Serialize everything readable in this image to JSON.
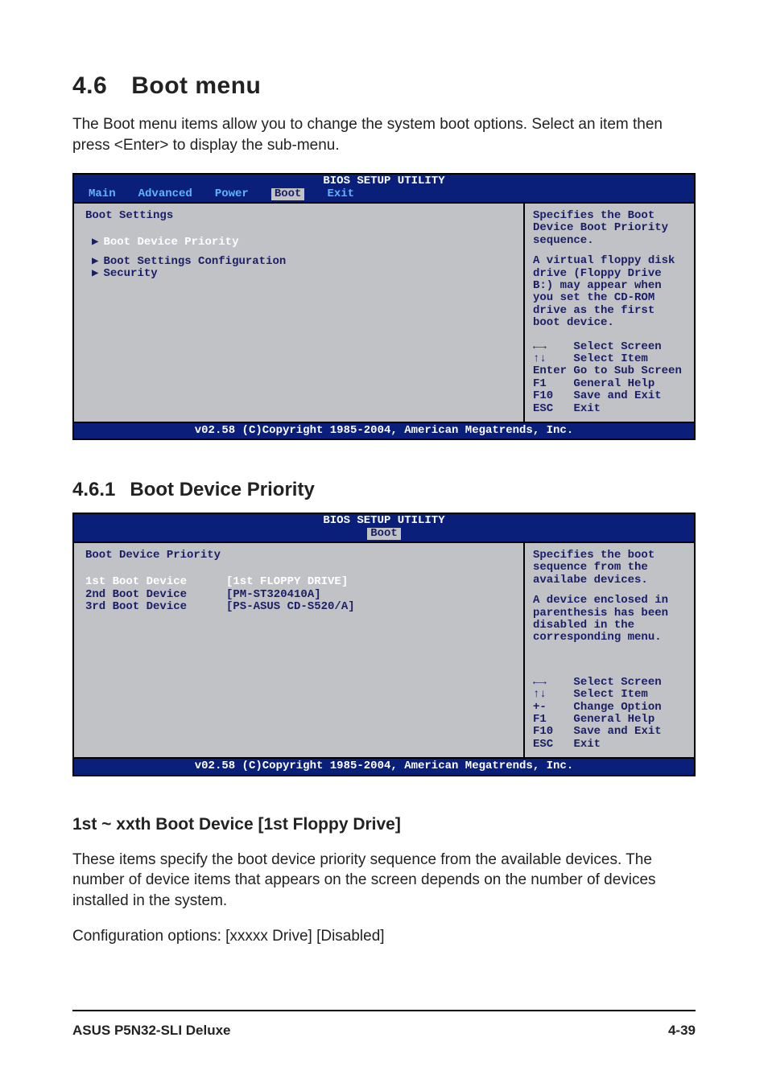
{
  "section": {
    "number": "4.6",
    "title": "Boot menu"
  },
  "intro": "The Boot menu items allow you to change the system boot options. Select an item then press <Enter> to display the sub-menu.",
  "bios1": {
    "title": "BIOS SETUP UTILITY",
    "tabs": {
      "main": "Main",
      "advanced": "Advanced",
      "power": "Power",
      "boot": "Boot",
      "exit": "Exit"
    },
    "heading": "Boot Settings",
    "items": {
      "a": "Boot Device Priority",
      "b": "Boot Settings Configuration",
      "c": "Security"
    },
    "help1": "Specifies the Boot Device Boot Priority sequence.",
    "help2": "A virtual floppy disk drive (Floppy Drive B:) may appear when you set the CD-ROM drive as the first boot device.",
    "keys": {
      "k1": {
        "sym": "←→",
        "txt": "Select Screen"
      },
      "k2": {
        "sym": "↑↓",
        "txt": "Select Item"
      },
      "k3": {
        "sym": "Enter",
        "txt": "Go to Sub Screen"
      },
      "k4": {
        "sym": "F1",
        "txt": "General Help"
      },
      "k5": {
        "sym": "F10",
        "txt": "Save and Exit"
      },
      "k6": {
        "sym": "ESC",
        "txt": "Exit"
      }
    },
    "footer": "v02.58 (C)Copyright 1985-2004, American Megatrends, Inc."
  },
  "subsection": {
    "number": "4.6.1",
    "title": "Boot Device Priority"
  },
  "bios2": {
    "title": "BIOS SETUP UTILITY",
    "tab": "Boot",
    "heading": "Boot Device Priority",
    "rows": {
      "r1": {
        "k": "1st Boot Device",
        "v": "[1st FLOPPY DRIVE]"
      },
      "r2": {
        "k": "2nd Boot Device",
        "v": "[PM-ST320410A]"
      },
      "r3": {
        "k": "3rd Boot Device",
        "v": "[PS-ASUS CD-S520/A]"
      }
    },
    "help1": "Specifies the boot sequence from the availabe devices.",
    "help2": "A device enclosed in parenthesis has been disabled in the corresponding menu.",
    "keys": {
      "k1": {
        "sym": "←→",
        "txt": "Select Screen"
      },
      "k2": {
        "sym": "↑↓",
        "txt": "Select Item"
      },
      "k3": {
        "sym": "+-",
        "txt": "Change Option"
      },
      "k4": {
        "sym": "F1",
        "txt": "General Help"
      },
      "k5": {
        "sym": "F10",
        "txt": "Save and Exit"
      },
      "k6": {
        "sym": "ESC",
        "txt": "Exit"
      }
    },
    "footer": "v02.58 (C)Copyright 1985-2004, American Megatrends, Inc."
  },
  "option": {
    "heading": "1st ~ xxth Boot Device [1st Floppy Drive]",
    "p1": "These items specify the boot device priority sequence from the available devices. The number of device items that appears on the screen depends on the number of devices installed in the system.",
    "p2": "Configuration options: [xxxxx Drive] [Disabled]"
  },
  "footer": {
    "left": "ASUS P5N32-SLI Deluxe",
    "right": "4-39"
  }
}
